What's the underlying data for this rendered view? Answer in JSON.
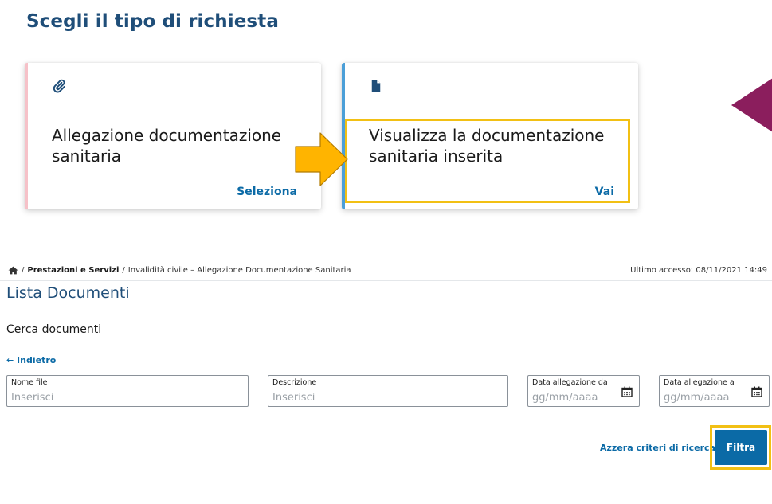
{
  "heading": "Scegli il tipo di richiesta",
  "cards": [
    {
      "title": "Allegazione documentazione sanitaria",
      "link": "Seleziona",
      "icon": "paperclip-icon"
    },
    {
      "title": "Visualizza la documentazione sanitaria inserita",
      "link": "Vai",
      "icon": "document-icon"
    }
  ],
  "breadcrumb": {
    "home_icon": "home-icon",
    "sep": "/",
    "item1": "Prestazioni e Servizi",
    "item2": "Invalidità civile – Allegazione Documentazione Sanitaria"
  },
  "last_access": "Ultimo accesso: 08/11/2021 14:49",
  "list_title": "Lista Documenti",
  "search_title": "Cerca documenti",
  "back_link": "← Indietro",
  "fields": {
    "filename": {
      "label": "Nome file",
      "placeholder": "Inserisci"
    },
    "description": {
      "label": "Descrizione",
      "placeholder": "Inserisci"
    },
    "date_from": {
      "label": "Data allegazione da",
      "placeholder": "gg/mm/aaaa"
    },
    "date_to": {
      "label": "Data allegazione a",
      "placeholder": "gg/mm/aaaa"
    }
  },
  "reset_link": "Azzera criteri di ricerca",
  "filter_button": "Filtra",
  "colors": {
    "primary": "#0b6aa6",
    "heading": "#1f4e79",
    "highlight": "#f2c014",
    "arrow": "#ffb400",
    "triangle": "#8b1e5d"
  }
}
